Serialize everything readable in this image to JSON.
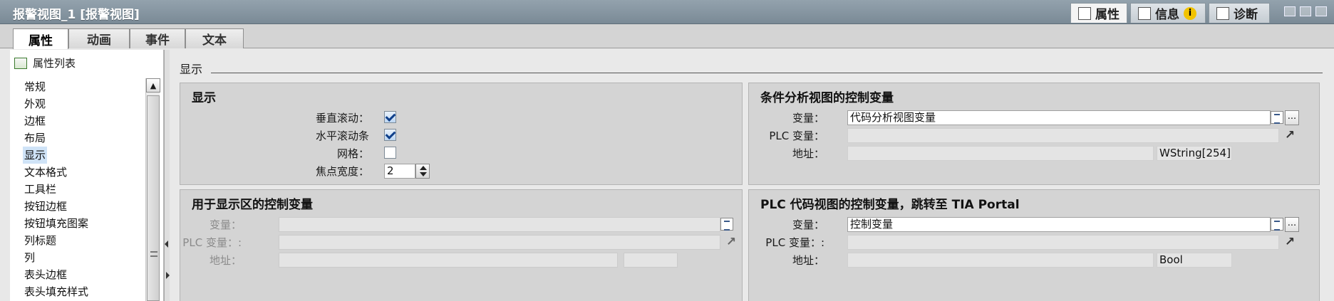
{
  "window": {
    "title": "报警视图_1 [报警视图]",
    "inspector_tabs": [
      {
        "label": "属性",
        "icon": "properties-icon",
        "active": true
      },
      {
        "label": "信息",
        "icon": "info-icon",
        "badge": "i"
      },
      {
        "label": "诊断",
        "icon": "diagnostics-icon"
      }
    ]
  },
  "subtabs": [
    "属性",
    "动画",
    "事件",
    "文本"
  ],
  "left": {
    "header": "属性列表",
    "items": [
      "常规",
      "外观",
      "边框",
      "布局",
      "显示",
      "文本格式",
      "工具栏",
      "按钮边框",
      "按钮填充图案",
      "列标题",
      "列",
      "表头边框",
      "表头填充样式"
    ],
    "selected_index": 4
  },
  "section": {
    "title": "显示"
  },
  "display_group": {
    "title": "显示",
    "vertical_scroll_label": "垂直滚动：",
    "vertical_scroll_checked": true,
    "horizontal_scroll_label": "水平滚动条",
    "horizontal_scroll_checked": true,
    "grid_label": "网格：",
    "grid_checked": false,
    "focus_width_label": "焦点宽度：",
    "focus_width_value": "2"
  },
  "display_area_group": {
    "title": "用于显示区的控制变量",
    "variable_label": "变量：",
    "plc_variable_label": "PLC 变量：:",
    "address_label": "地址："
  },
  "cond_group": {
    "title": "条件分析视图的控制变量",
    "variable_label": "变量：",
    "variable_value": "代码分析视图变量",
    "plc_variable_label": "PLC 变量：",
    "address_label": "地址：",
    "address_type": "WString[254]"
  },
  "plc_group": {
    "title": "PLC 代码视图的控制变量，跳转至 TIA Portal",
    "variable_label": "变量：",
    "variable_value": "控制变量",
    "plc_variable_label": "PLC 变量：:",
    "address_label": "地址：",
    "address_type": "Bool"
  }
}
